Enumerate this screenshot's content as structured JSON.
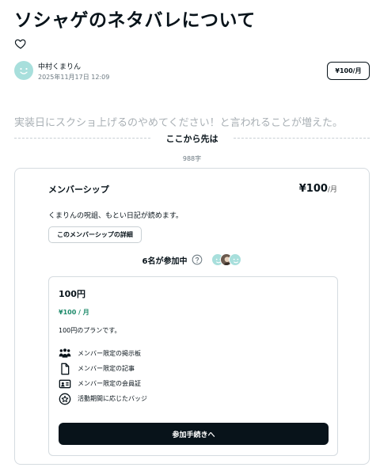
{
  "article": {
    "title": "ソシャゲのネタバレについて",
    "excerpt": "実装日にスクショ上げるのやめてください！と言われることが増えた。"
  },
  "author": {
    "name": "中村くまりん",
    "date": "2025年11月17日 12:09",
    "price_label": "¥100/月"
  },
  "paywall": {
    "divider_label": "ここから先は",
    "char_count": "988字"
  },
  "membership": {
    "title": "メンバーシップ",
    "price_amount": "¥100",
    "price_period": "/月",
    "description": "くまりんの呪詛、もとい日記が読めます。",
    "detail_button": "このメンバーシップの詳細",
    "participants_label": "6名が参加中"
  },
  "plan": {
    "name": "100円",
    "price": "¥100 / 月",
    "description": "100円のプランです。",
    "benefits": [
      {
        "icon": "people-icon",
        "label": "メンバー限定の掲示板"
      },
      {
        "icon": "document-icon",
        "label": "メンバー限定の記事"
      },
      {
        "icon": "id-card-icon",
        "label": "メンバー限定の会員証"
      },
      {
        "icon": "badge-icon",
        "label": "活動期間に応じたバッジ"
      }
    ],
    "join_button": "参加手続きへ"
  }
}
